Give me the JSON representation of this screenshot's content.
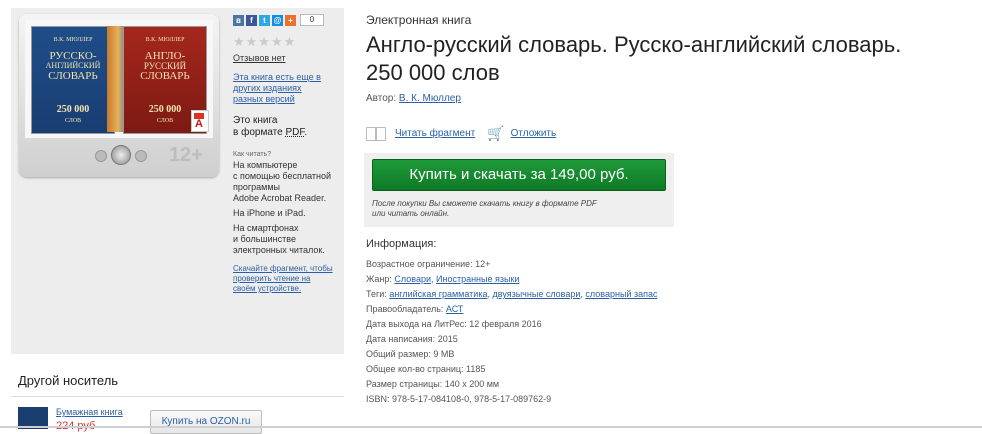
{
  "share": {
    "count": "0",
    "icons": [
      "vk-icon",
      "facebook-icon",
      "twitter-icon",
      "mail-icon",
      "plus-icon"
    ]
  },
  "rating": {
    "stars_filled": 0,
    "stars_total": 5,
    "reviews_label": "Отзывов нет"
  },
  "other_editions_link": "Эта книга есть еще в других изданиях разных версий",
  "format": {
    "line1": "Это книга",
    "line2": "в формате ",
    "format_name": "PDF",
    "suffix": "."
  },
  "how_to_read": {
    "title": "Как читать?",
    "para1": [
      "На компьютере",
      "с помощью бесплатной",
      "программы",
      "Adobe Acrobat Reader."
    ],
    "para2": "На iPhone и iPad.",
    "para3": [
      "На смартфонах",
      "и большинстве",
      "электронных читалок."
    ],
    "download_sample_link": "Скачайте фрагмент, чтобы проверить чтение на своём устройстве."
  },
  "cover": {
    "age_badge": "12+",
    "book_blue": {
      "author": "В.К. МЮЛЛЕР",
      "title1": "РУССКО-",
      "title2": "АНГЛИЙСКИЙ",
      "title3": "СЛОВАРЬ",
      "count": "250 000",
      "unit": "СЛОВ"
    },
    "book_red": {
      "author": "В.К. МЮЛЛЕР",
      "title1": "АНГЛО-",
      "title2": "РУССКИЙ",
      "title3": "СЛОВАРЬ",
      "count": "250 000",
      "unit": "СЛОВ"
    }
  },
  "other_carrier": {
    "title": "Другой носитель",
    "paper_book_link": "Бумажная книга",
    "price_fragment": "224 руб",
    "ozon_button": "Купить на OZON.ru"
  },
  "product": {
    "type_label": "Электронная книга",
    "title_line1": "Англо-русский словарь. Русско-английский словарь.",
    "title_line2": "250 000 слов",
    "author_label": "Автор: ",
    "author_name": "В. К. Мюллер",
    "read_fragment": "Читать фрагмент",
    "postpone": "Отложить"
  },
  "buy": {
    "button_label": "Купить и скачать за 149,00 руб.",
    "note_line1": "После покупки Вы сможете скачать книгу в формате PDF",
    "note_line2": "или читать онлайн."
  },
  "info": {
    "heading": "Информация:",
    "age_label": "Возрастное ограничение: ",
    "age_value": "12+",
    "genre_label": "Жанр: ",
    "genre_1": "Словари",
    "genre_2": "Иностранные языки",
    "tags_label": "Теги: ",
    "tag_1": "английская грамматика",
    "tag_2": "двуязычные словари",
    "tag_3": "словарный запас",
    "rightholder_label": "Правообладатель: ",
    "rightholder": "АСТ",
    "release_label": "Дата выхода на ЛитРес: ",
    "release_value": "12 февраля 2016",
    "written_label": "Дата написания: ",
    "written_value": "2015",
    "size_label": "Общий размер: ",
    "size_value": "9 MB",
    "pages_label": "Общее кол-во страниц: ",
    "pages_value": "1185",
    "page_size_label": "Размер страницы: ",
    "page_size_value": "140 x 200 мм",
    "isbn_label": "ISBN: ",
    "isbn_value": "978-5-17-084108-0, 978-5-17-089762-9"
  },
  "colors": {
    "link": "#2b5fa5",
    "buy_button": "#148a2f",
    "panel_bg": "#ededed"
  }
}
